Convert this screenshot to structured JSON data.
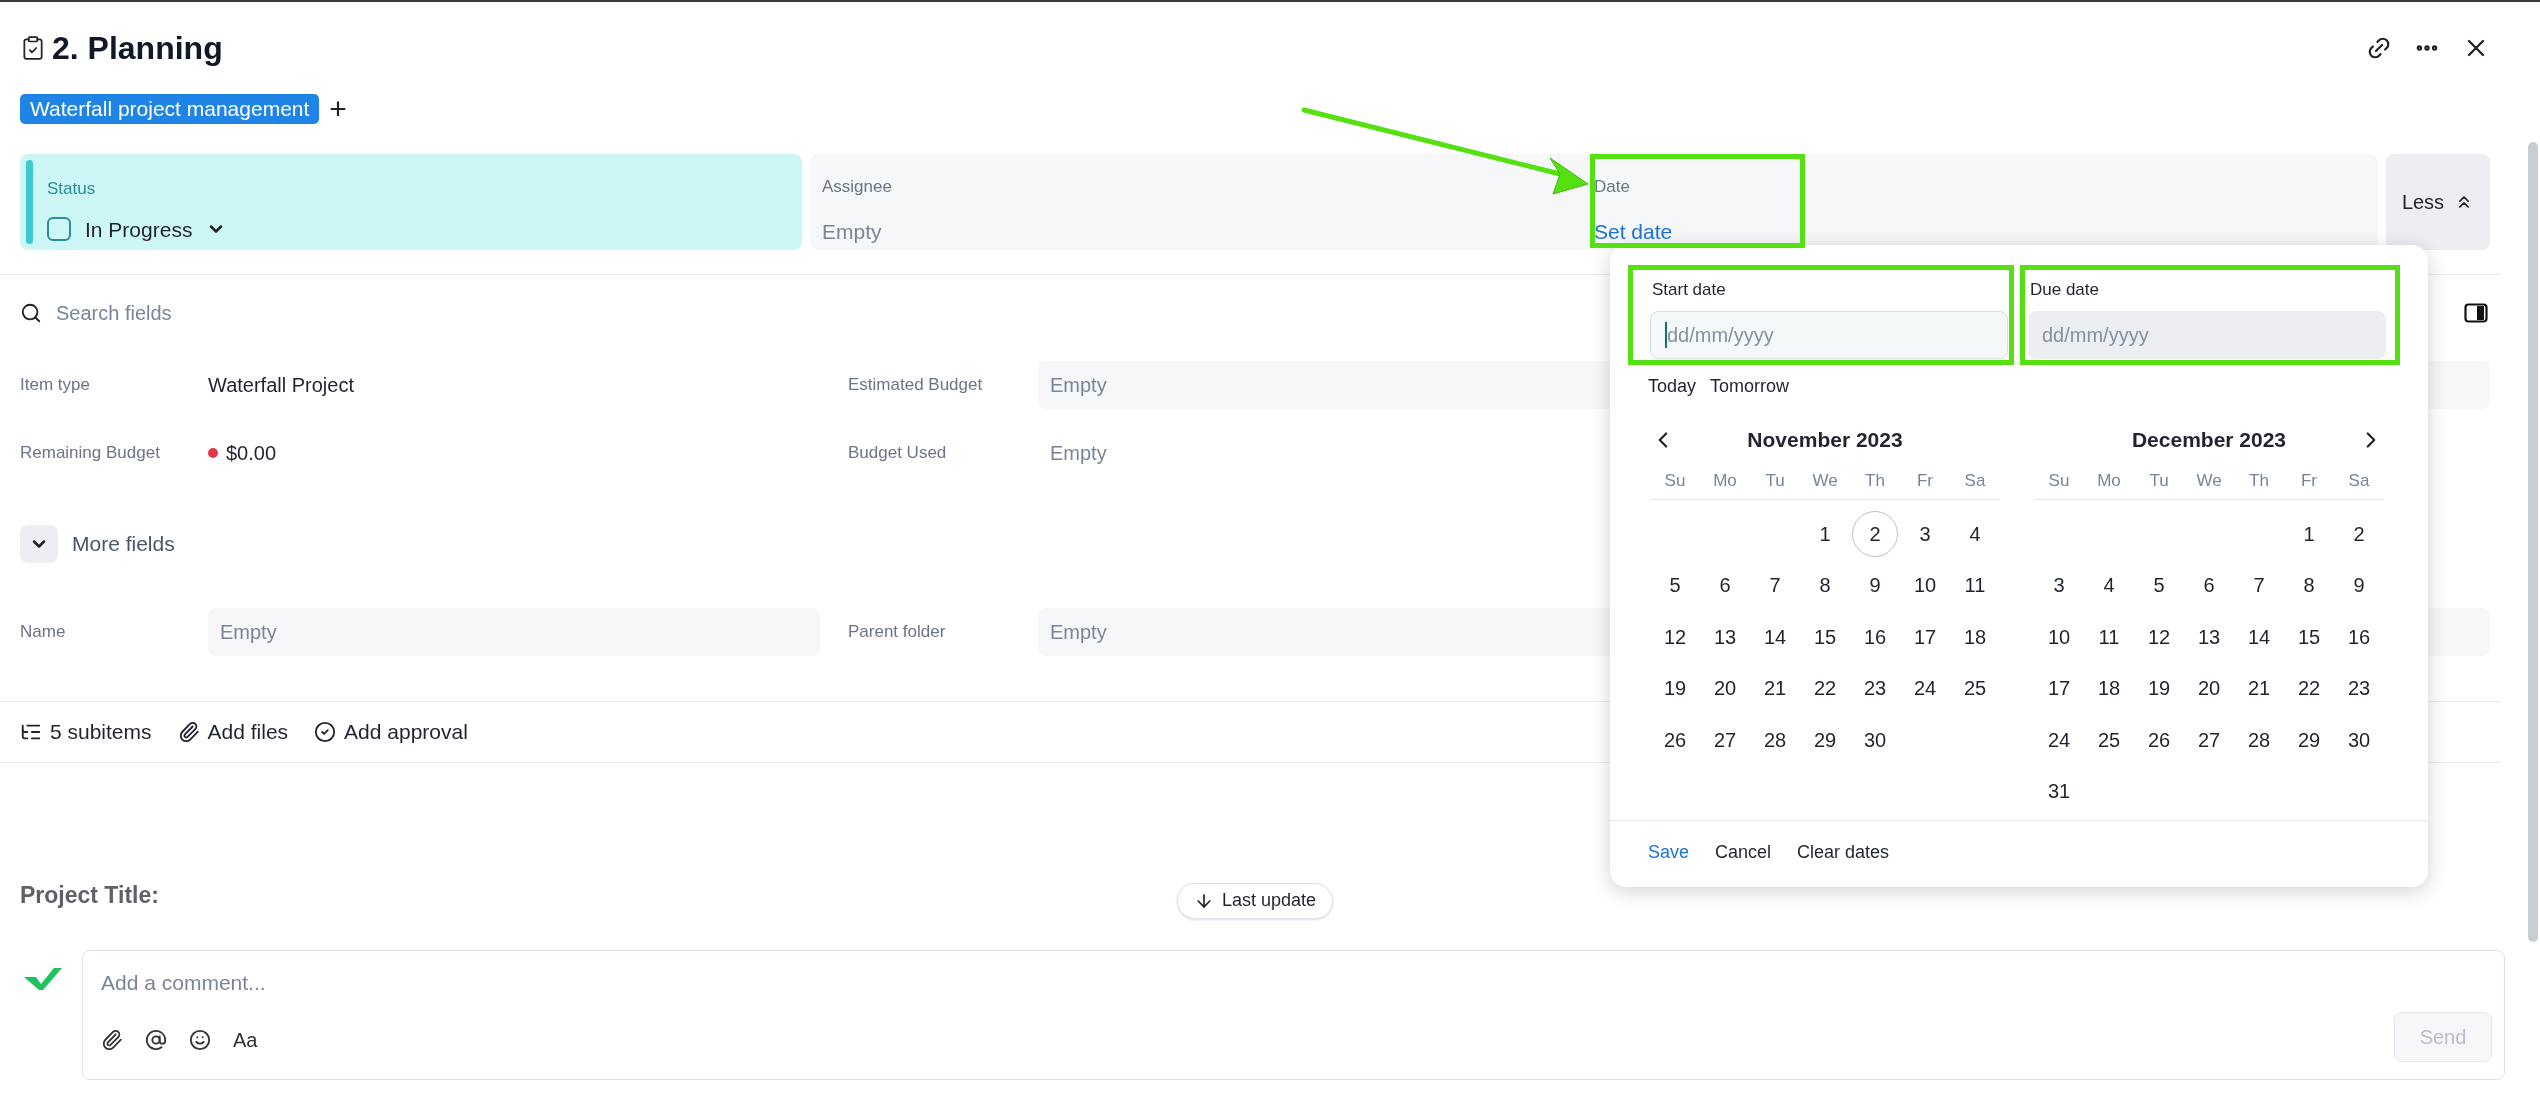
{
  "header": {
    "title": "2. Planning",
    "tag": "Waterfall project management",
    "tag_add": "+"
  },
  "summary": {
    "status": {
      "label": "Status",
      "value": "In Progress",
      "checked": false
    },
    "assignee": {
      "label": "Assignee",
      "value": "Empty"
    },
    "date": {
      "label": "Date",
      "value": "Set date"
    },
    "less": "Less"
  },
  "search": {
    "placeholder": "Search fields"
  },
  "fields": [
    {
      "label": "Item type",
      "value": "Waterfall Project",
      "kind": "text"
    },
    {
      "label": "Estimated Budget",
      "value": "Empty",
      "kind": "input"
    },
    {
      "label": "Remaining Budget",
      "value": "$0.00",
      "kind": "money",
      "color": "#e8334a"
    },
    {
      "label": "Budget Used",
      "value": "Empty",
      "kind": "empty"
    }
  ],
  "more_fields": {
    "label": "More fields",
    "expanded": false
  },
  "extra_fields": [
    {
      "label": "Name",
      "value": "Empty",
      "kind": "input"
    },
    {
      "label": "Parent folder",
      "value": "Empty",
      "kind": "input"
    }
  ],
  "toolbar": [
    "5 subitems",
    "Add files",
    "Add approval"
  ],
  "project_title": "Project Title:",
  "last_update": "Last update",
  "comment": {
    "placeholder": "Add a comment...",
    "format": "Aa",
    "send": "Send"
  },
  "date_picker": {
    "inputs": [
      {
        "label": "Start date",
        "placeholder": "dd/mm/yyyy",
        "focused": true
      },
      {
        "label": "Due date",
        "placeholder": "dd/mm/yyyy",
        "focused": false
      }
    ],
    "shortcuts": [
      "Today",
      "Tomorrow"
    ],
    "months": [
      {
        "title": "November 2023",
        "weekdays": [
          "Su",
          "Mo",
          "Tu",
          "We",
          "Th",
          "Fr",
          "Sa"
        ],
        "weeks": [
          {
            "kind": "leading",
            "days": [
              {
                "day": "1",
                "today": false
              },
              {
                "day": "2",
                "today": true
              },
              {
                "day": "3",
                "today": false
              },
              {
                "day": "4",
                "today": false
              }
            ]
          },
          {
            "kind": "full",
            "days": [
              {
                "day": "5",
                "today": false
              },
              {
                "day": "6",
                "today": false
              },
              {
                "day": "7",
                "today": false
              },
              {
                "day": "8",
                "today": false
              },
              {
                "day": "9",
                "today": false
              },
              {
                "day": "10",
                "today": false
              },
              {
                "day": "11",
                "today": false
              }
            ]
          },
          {
            "kind": "full",
            "days": [
              {
                "day": "12",
                "today": false
              },
              {
                "day": "13",
                "today": false
              },
              {
                "day": "14",
                "today": false
              },
              {
                "day": "15",
                "today": false
              },
              {
                "day": "16",
                "today": false
              },
              {
                "day": "17",
                "today": false
              },
              {
                "day": "18",
                "today": false
              }
            ]
          },
          {
            "kind": "full",
            "days": [
              {
                "day": "19",
                "today": false
              },
              {
                "day": "20",
                "today": false
              },
              {
                "day": "21",
                "today": false
              },
              {
                "day": "22",
                "today": false
              },
              {
                "day": "23",
                "today": false
              },
              {
                "day": "24",
                "today": false
              },
              {
                "day": "25",
                "today": false
              }
            ]
          },
          {
            "kind": "trailing",
            "days": [
              {
                "day": "26",
                "today": false
              },
              {
                "day": "27",
                "today": false
              },
              {
                "day": "28",
                "today": false
              },
              {
                "day": "29",
                "today": false
              },
              {
                "day": "30",
                "today": false
              }
            ]
          }
        ]
      },
      {
        "title": "December 2023",
        "weekdays": [
          "Su",
          "Mo",
          "Tu",
          "We",
          "Th",
          "Fr",
          "Sa"
        ],
        "weeks": [
          {
            "kind": "leading",
            "days": [
              {
                "day": "1",
                "today": false
              },
              {
                "day": "2",
                "today": false
              }
            ]
          },
          {
            "kind": "full",
            "days": [
              {
                "day": "3",
                "today": false
              },
              {
                "day": "4",
                "today": false
              },
              {
                "day": "5",
                "today": false
              },
              {
                "day": "6",
                "today": false
              },
              {
                "day": "7",
                "today": false
              },
              {
                "day": "8",
                "today": false
              },
              {
                "day": "9",
                "today": false
              }
            ]
          },
          {
            "kind": "full",
            "days": [
              {
                "day": "10",
                "today": false
              },
              {
                "day": "11",
                "today": false
              },
              {
                "day": "12",
                "today": false
              },
              {
                "day": "13",
                "today": false
              },
              {
                "day": "14",
                "today": false
              },
              {
                "day": "15",
                "today": false
              },
              {
                "day": "16",
                "today": false
              }
            ]
          },
          {
            "kind": "full",
            "days": [
              {
                "day": "17",
                "today": false
              },
              {
                "day": "18",
                "today": false
              },
              {
                "day": "19",
                "today": false
              },
              {
                "day": "20",
                "today": false
              },
              {
                "day": "21",
                "today": false
              },
              {
                "day": "22",
                "today": false
              },
              {
                "day": "23",
                "today": false
              }
            ]
          },
          {
            "kind": "full",
            "days": [
              {
                "day": "24",
                "today": false
              },
              {
                "day": "25",
                "today": false
              },
              {
                "day": "26",
                "today": false
              },
              {
                "day": "27",
                "today": false
              },
              {
                "day": "28",
                "today": false
              },
              {
                "day": "29",
                "today": false
              },
              {
                "day": "30",
                "today": false
              }
            ]
          },
          {
            "kind": "trailing",
            "days": [
              {
                "day": "31",
                "today": false
              }
            ]
          }
        ]
      }
    ],
    "actions": [
      "Save",
      "Cancel",
      "Clear dates"
    ]
  }
}
